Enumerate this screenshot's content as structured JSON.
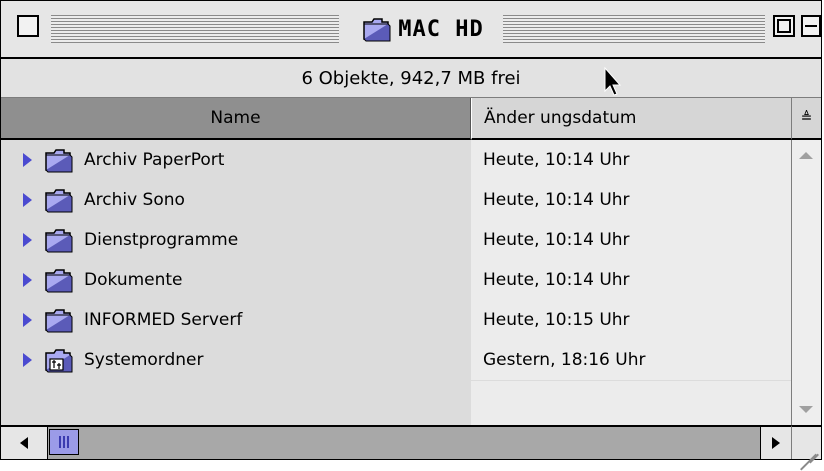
{
  "window": {
    "title": "MAC HD",
    "info": "6 Objekte, 942,7 MB frei"
  },
  "columns": {
    "name": "Name",
    "date": "Änder ungsdatum"
  },
  "rows": [
    {
      "name": "Archiv PaperPort",
      "date": "Heute, 10:14 Uhr",
      "icon": "folder-icon"
    },
    {
      "name": "Archiv Sono",
      "date": "Heute, 10:14 Uhr",
      "icon": "folder-icon"
    },
    {
      "name": "Dienstprogramme",
      "date": "Heute, 10:14 Uhr",
      "icon": "folder-icon"
    },
    {
      "name": "Dokumente",
      "date": "Heute, 10:14 Uhr",
      "icon": "folder-icon"
    },
    {
      "name": "INFORMED Serverf",
      "date": "Heute, 10:15 Uhr",
      "icon": "folder-icon"
    },
    {
      "name": "Systemordner",
      "date": "Gestern, 18:16 Uhr",
      "icon": "system-folder-icon"
    }
  ],
  "colors": {
    "disclosure": "#4a4ad0",
    "folder": "#a9a9f0",
    "scroll_thumb": "#9b9be8"
  }
}
